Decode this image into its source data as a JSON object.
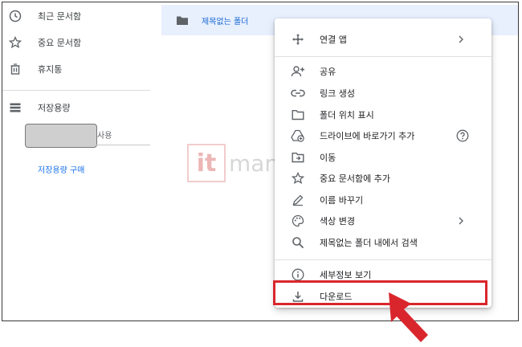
{
  "sidebar": {
    "items": [
      {
        "label": "최근 문서함",
        "icon": "clock-icon"
      },
      {
        "label": "중요 문서함",
        "icon": "star-icon"
      },
      {
        "label": "휴지통",
        "icon": "trash-icon"
      },
      {
        "label": "저장용량",
        "icon": "storage-icon"
      }
    ],
    "quota_used_label": "사용",
    "buy_storage_label": "저장용량 구매"
  },
  "folder": {
    "name": "제목없는 폴더",
    "icon": "folder-icon"
  },
  "watermark": {
    "badge": "it",
    "text": "manual.net"
  },
  "context_menu": {
    "items": [
      {
        "label": "연결 앱",
        "icon": "move-icon",
        "submenu": true
      },
      {
        "label": "공유",
        "icon": "person-add-icon"
      },
      {
        "label": "링크 생성",
        "icon": "link-icon"
      },
      {
        "label": "폴더 위치 표시",
        "icon": "folder-outline-icon"
      },
      {
        "label": "드라이브에 바로가기 추가",
        "icon": "drive-add-icon",
        "help": true
      },
      {
        "label": "이동",
        "icon": "move-to-icon"
      },
      {
        "label": "중요 문서함에 추가",
        "icon": "star-outline-icon"
      },
      {
        "label": "이름 바꾸기",
        "icon": "pencil-icon"
      },
      {
        "label": "색상 변경",
        "icon": "palette-icon",
        "submenu": true
      },
      {
        "label": "제목없는 폴더 내에서 검색",
        "icon": "search-icon"
      },
      {
        "label": "세부정보 보기",
        "icon": "info-icon"
      },
      {
        "label": "다운로드",
        "icon": "download-icon"
      }
    ]
  },
  "colors": {
    "accent_blue": "#1a73e8",
    "selection_bg": "#e8f0fe",
    "highlight_red": "#d9262c"
  }
}
